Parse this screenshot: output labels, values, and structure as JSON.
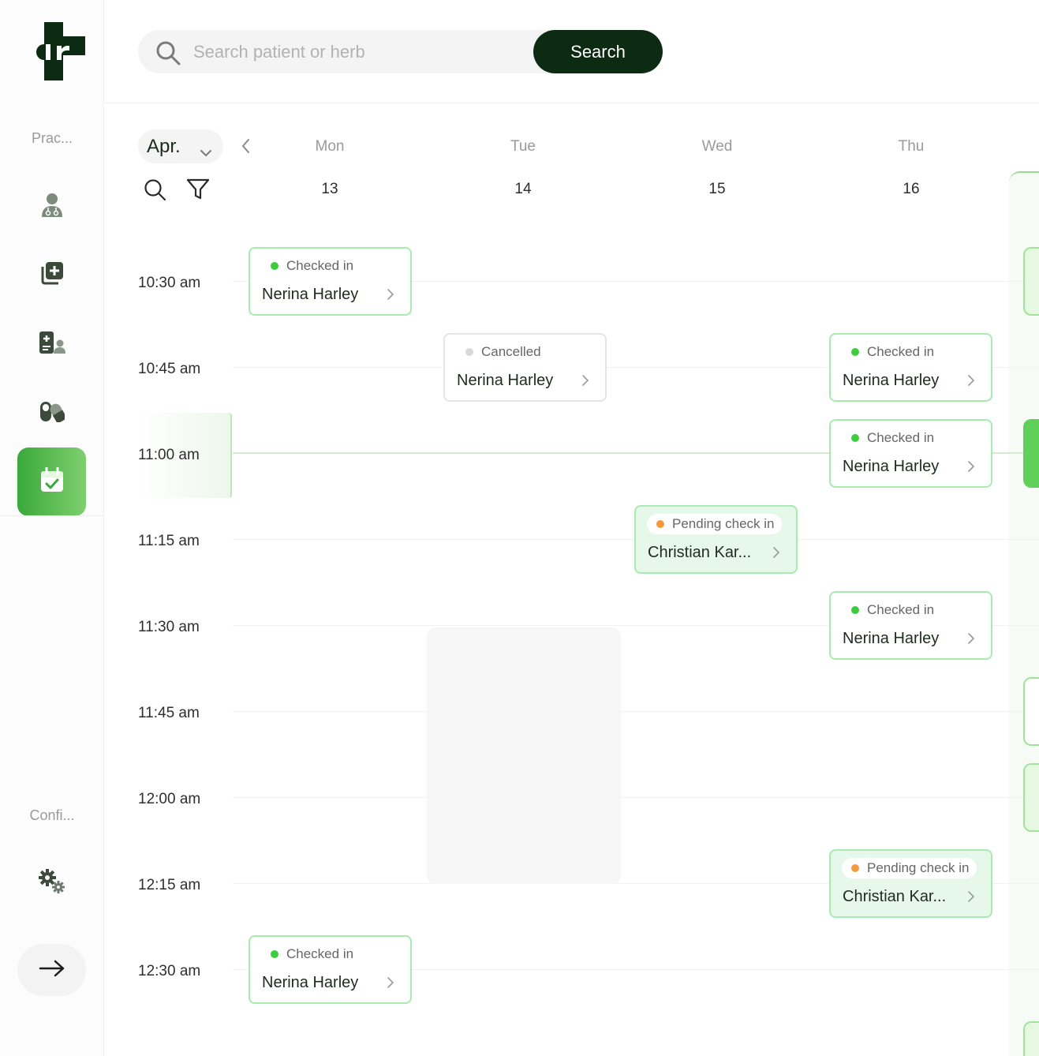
{
  "sidebar": {
    "practice_label": "Prac...",
    "config_label": "Confi...",
    "items": [
      {
        "icon": "doctor-icon"
      },
      {
        "icon": "add-record-icon"
      },
      {
        "icon": "patient-records-icon"
      },
      {
        "icon": "pills-icon"
      },
      {
        "icon": "calendar-check-icon",
        "active": true
      }
    ],
    "settings_icon": "gears-icon",
    "logout_icon": "arrow-right-icon"
  },
  "search": {
    "placeholder": "Search patient or herb",
    "value": "",
    "button_label": "Search"
  },
  "calendar": {
    "month": "Apr.",
    "days": [
      {
        "name": "Mon",
        "date": "13"
      },
      {
        "name": "Tue",
        "date": "14"
      },
      {
        "name": "Wed",
        "date": "15"
      },
      {
        "name": "Thu",
        "date": "16"
      }
    ],
    "times": [
      "10:30 am",
      "10:45 am",
      "11:00 am",
      "11:15 am",
      "11:30 am",
      "11:45 am",
      "12:00 am",
      "12:15 am",
      "12:30 am"
    ],
    "appointments": [
      {
        "status": "Checked in",
        "name": "Nerina Harley"
      },
      {
        "status": "Cancelled",
        "name": "Nerina Harley"
      },
      {
        "status": "Checked in",
        "name": "Nerina Harley"
      },
      {
        "status": "Checked in",
        "name": "Nerina Harley"
      },
      {
        "status": "Pending check in",
        "name": "Christian Kar..."
      },
      {
        "status": "Checked in",
        "name": "Nerina Harley"
      },
      {
        "status": "Pending check in",
        "name": "Christian Kar..."
      },
      {
        "status": "Checked in",
        "name": "Nerina Harley"
      }
    ]
  },
  "colors": {
    "brand_dark": "#0d2b12",
    "accent_green": "#3aa83a",
    "checked_in": "#3ccd3c",
    "pending": "#f59a3c",
    "cancelled": "#d8d8d8"
  }
}
